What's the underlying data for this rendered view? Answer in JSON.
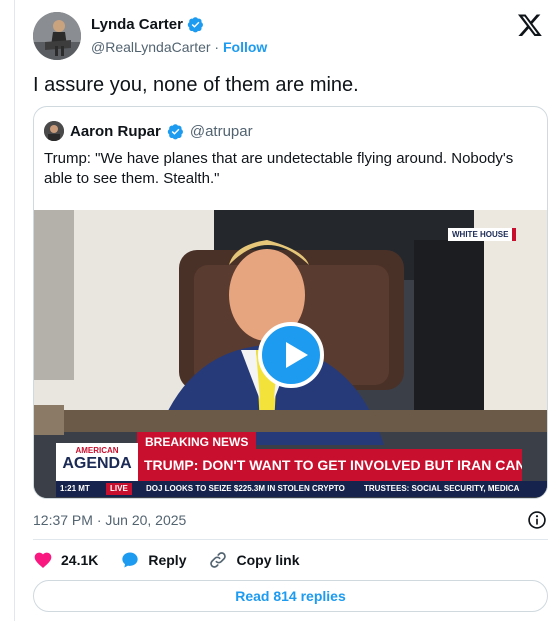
{
  "author": {
    "name": "Lynda Carter",
    "handle": "@RealLyndaCarter",
    "separator": "·",
    "follow_label": "Follow"
  },
  "tweet": {
    "text": "I assure you, none of them are mine."
  },
  "quote": {
    "name": "Aaron Rupar",
    "handle": "@atrupar",
    "text": "Trump: \"We have planes that are undetectable flying around. Nobody's able to see them. Stealth.\""
  },
  "video": {
    "location_badge": "WHITE HOUSE",
    "breaking_label": "BREAKING NEWS",
    "brand_top": "AMERICAN",
    "brand_bottom": "AGENDA",
    "headline": "TRUMP: DON'T WANT TO GET INVOLVED BUT IRAN CAN'T HAVE A NUKE",
    "time": "1:21 MT",
    "live_label": "LIVE",
    "crawl": "DOJ LOOKS TO SEIZE $225.3M IN STOLEN CRYPTO",
    "crawl2": "TRUSTEES: SOCIAL SECURITY, MEDICA"
  },
  "meta": {
    "timestamp": "12:37 PM · Jun 20, 2025"
  },
  "actions": {
    "likes": "24.1K",
    "reply_label": "Reply",
    "copy_link_label": "Copy link"
  },
  "replies_button": "Read 814 replies",
  "colors": {
    "accent": "#1d9bf0",
    "like": "#f91880",
    "news_red": "#c8102e",
    "news_navy": "#16244d"
  },
  "icons": [
    "verified-badge-icon",
    "x-logo-icon",
    "play-icon",
    "info-icon",
    "heart-icon",
    "reply-bubble-icon",
    "link-icon"
  ]
}
